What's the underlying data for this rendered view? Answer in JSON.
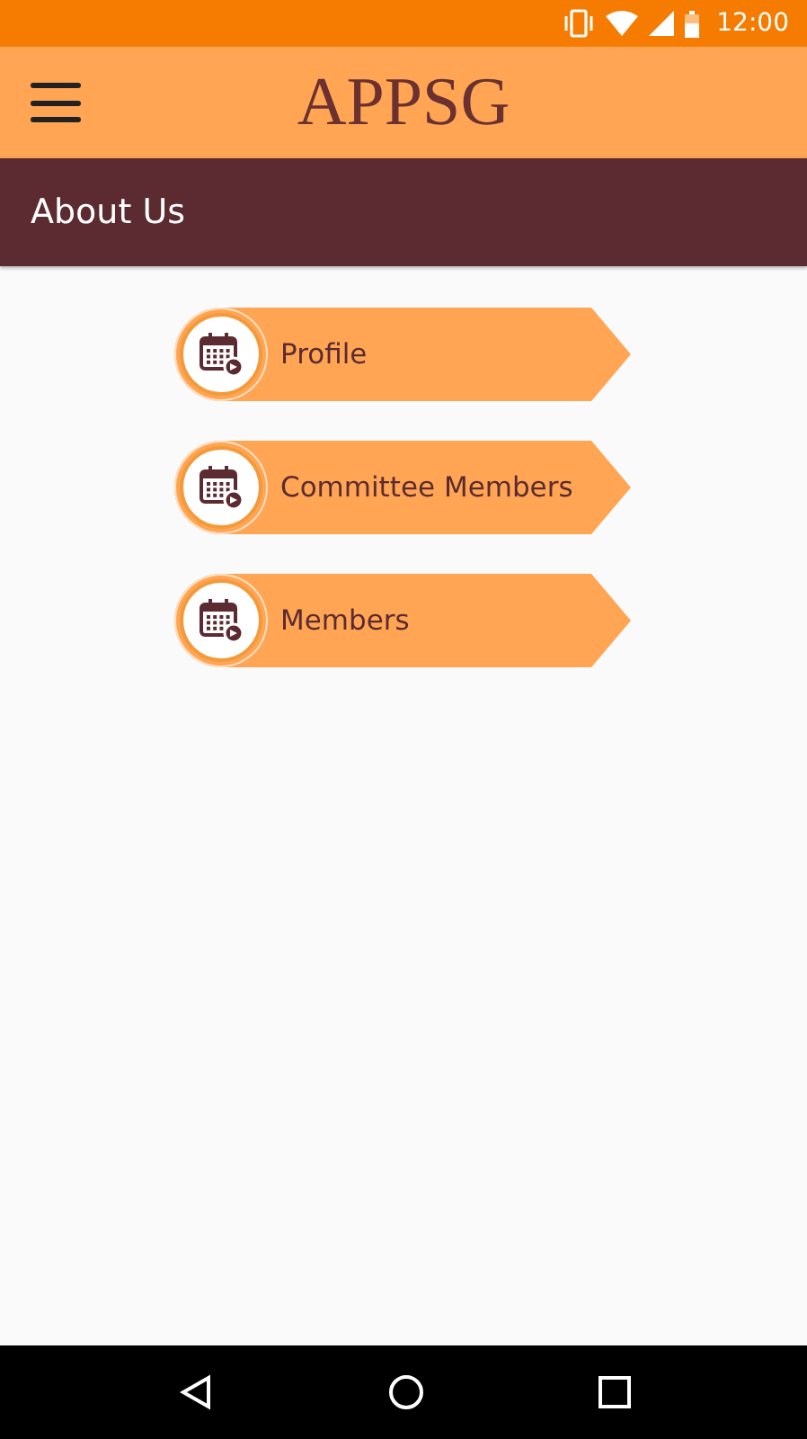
{
  "status_bar": {
    "time": "12:00"
  },
  "app_bar": {
    "title": "APPSG"
  },
  "section": {
    "title": "About Us"
  },
  "menu_items": [
    {
      "label": "Profile"
    },
    {
      "label": "Committee Members"
    },
    {
      "label": "Members"
    }
  ]
}
